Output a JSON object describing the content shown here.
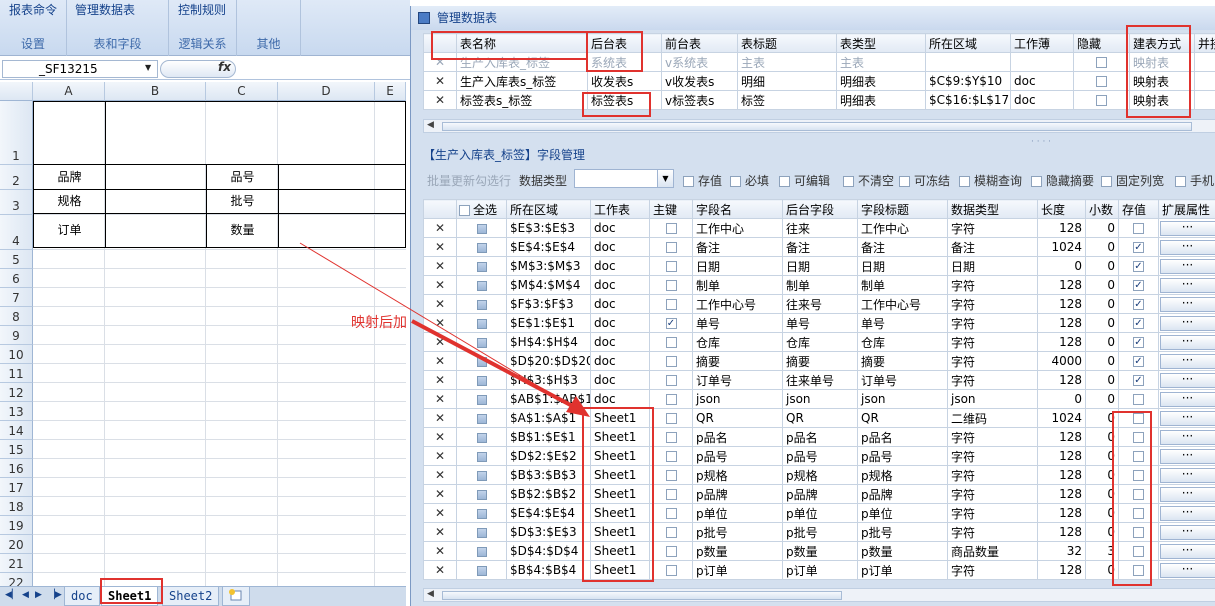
{
  "ribbon": {
    "groups": [
      {
        "button": "报表命令",
        "label": "设置"
      },
      {
        "button": "管理数据表",
        "label": "表和字段"
      },
      {
        "button": "控制规则",
        "label": "逻辑关系"
      },
      {
        "button": "",
        "label": "其他"
      }
    ]
  },
  "formula_bar": {
    "name_box": "_SF13215",
    "fx": "fx"
  },
  "sheet": {
    "columns": [
      "A",
      "B",
      "C",
      "D",
      "E"
    ],
    "rows": [
      "1",
      "2",
      "3",
      "4",
      "5",
      "6",
      "7",
      "8",
      "9",
      "10",
      "11",
      "12",
      "13",
      "14",
      "15",
      "16",
      "17",
      "18",
      "19",
      "20",
      "21",
      "22"
    ],
    "labels": {
      "brand": "品牌",
      "model": "品号",
      "spec": "规格",
      "batch": "批号",
      "order": "订单",
      "qty": "数量"
    },
    "tabs": [
      "doc",
      "Sheet1",
      "Sheet2"
    ],
    "active_tab": "Sheet1"
  },
  "annotation": "映射后加",
  "window": {
    "title": "管理数据表",
    "table_grid": {
      "headers": [
        "表名称",
        "后台表",
        "前台表",
        "表标题",
        "表类型",
        "所在区域",
        "工作薄",
        "隐藏",
        "建表方式",
        "并接"
      ],
      "rows": [
        {
          "name": "生产入库表_标签",
          "back": "系统表",
          "front": "v系统表",
          "title": "主表",
          "type": "主表",
          "range": "",
          "book": "",
          "hidden": false,
          "mode": "映射表",
          "gray": true
        },
        {
          "name": "生产入库表s_标签",
          "back": "收发表s",
          "front": "v收发表s",
          "title": "明细",
          "type": "明细表",
          "range": "$C$9:$Y$10",
          "book": "doc",
          "hidden": false,
          "mode": "映射表",
          "gray": false
        },
        {
          "name": "标签表s_标签",
          "back": "标签表s",
          "front": "v标签表s",
          "title": "标签",
          "type": "明细表",
          "range": "$C$16:$L$17",
          "book": "doc",
          "hidden": false,
          "mode": "映射表",
          "gray": false
        }
      ]
    },
    "field_section": {
      "title": "【生产入库表_标签】字段管理",
      "batch_update": "批量更新勾选行",
      "type_label": "数据类型",
      "filters": [
        "存值",
        "必填",
        "可编辑",
        "不清空",
        "可冻结",
        "模糊查询",
        "隐藏摘要",
        "固定列宽",
        "手机"
      ]
    },
    "field_grid": {
      "headers": [
        "全选",
        "所在区域",
        "工作表",
        "主键",
        "字段名",
        "后台字段",
        "字段标题",
        "数据类型",
        "长度",
        "小数",
        "存值",
        "扩展属性"
      ],
      "rows": [
        {
          "range": "$E$3:$E$3",
          "sheet": "doc",
          "pk": false,
          "field": "工作中心",
          "back": "往来",
          "title": "工作中心",
          "dtype": "字符",
          "len": "128",
          "dec": "0",
          "store": false
        },
        {
          "range": "$E$4:$E$4",
          "sheet": "doc",
          "pk": false,
          "field": "备注",
          "back": "备注",
          "title": "备注",
          "dtype": "备注",
          "len": "1024",
          "dec": "0",
          "store": true
        },
        {
          "range": "$M$3:$M$3",
          "sheet": "doc",
          "pk": false,
          "field": "日期",
          "back": "日期",
          "title": "日期",
          "dtype": "日期",
          "len": "0",
          "dec": "0",
          "store": true
        },
        {
          "range": "$M$4:$M$4",
          "sheet": "doc",
          "pk": false,
          "field": "制单",
          "back": "制单",
          "title": "制单",
          "dtype": "字符",
          "len": "128",
          "dec": "0",
          "store": true
        },
        {
          "range": "$F$3:$F$3",
          "sheet": "doc",
          "pk": false,
          "field": "工作中心号",
          "back": "往来号",
          "title": "工作中心号",
          "dtype": "字符",
          "len": "128",
          "dec": "0",
          "store": true
        },
        {
          "range": "$E$1:$E$1",
          "sheet": "doc",
          "pk": true,
          "field": "单号",
          "back": "单号",
          "title": "单号",
          "dtype": "字符",
          "len": "128",
          "dec": "0",
          "store": true
        },
        {
          "range": "$H$4:$H$4",
          "sheet": "doc",
          "pk": false,
          "field": "仓库",
          "back": "仓库",
          "title": "仓库",
          "dtype": "字符",
          "len": "128",
          "dec": "0",
          "store": true
        },
        {
          "range": "$D$20:$D$20",
          "sheet": "doc",
          "pk": false,
          "field": "摘要",
          "back": "摘要",
          "title": "摘要",
          "dtype": "字符",
          "len": "4000",
          "dec": "0",
          "store": true
        },
        {
          "range": "$H$3:$H$3",
          "sheet": "doc",
          "pk": false,
          "field": "订单号",
          "back": "往来单号",
          "title": "订单号",
          "dtype": "字符",
          "len": "128",
          "dec": "0",
          "store": true
        },
        {
          "range": "$AB$1:$AB$1",
          "sheet": "doc",
          "pk": false,
          "field": "json",
          "back": "json",
          "title": "json",
          "dtype": "json",
          "len": "0",
          "dec": "0",
          "store": false
        },
        {
          "range": "$A$1:$A$1",
          "sheet": "Sheet1",
          "pk": false,
          "field": "QR",
          "back": "QR",
          "title": "QR",
          "dtype": "二维码",
          "len": "1024",
          "dec": "0",
          "store": false
        },
        {
          "range": "$B$1:$E$1",
          "sheet": "Sheet1",
          "pk": false,
          "field": "p品名",
          "back": "p品名",
          "title": "p品名",
          "dtype": "字符",
          "len": "128",
          "dec": "0",
          "store": false
        },
        {
          "range": "$D$2:$E$2",
          "sheet": "Sheet1",
          "pk": false,
          "field": "p品号",
          "back": "p品号",
          "title": "p品号",
          "dtype": "字符",
          "len": "128",
          "dec": "0",
          "store": false
        },
        {
          "range": "$B$3:$B$3",
          "sheet": "Sheet1",
          "pk": false,
          "field": "p规格",
          "back": "p规格",
          "title": "p规格",
          "dtype": "字符",
          "len": "128",
          "dec": "0",
          "store": false
        },
        {
          "range": "$B$2:$B$2",
          "sheet": "Sheet1",
          "pk": false,
          "field": "p品牌",
          "back": "p品牌",
          "title": "p品牌",
          "dtype": "字符",
          "len": "128",
          "dec": "0",
          "store": false
        },
        {
          "range": "$E$4:$E$4",
          "sheet": "Sheet1",
          "pk": false,
          "field": "p单位",
          "back": "p单位",
          "title": "p单位",
          "dtype": "字符",
          "len": "128",
          "dec": "0",
          "store": false
        },
        {
          "range": "$D$3:$E$3",
          "sheet": "Sheet1",
          "pk": false,
          "field": "p批号",
          "back": "p批号",
          "title": "p批号",
          "dtype": "字符",
          "len": "128",
          "dec": "0",
          "store": false
        },
        {
          "range": "$D$4:$D$4",
          "sheet": "Sheet1",
          "pk": false,
          "field": "p数量",
          "back": "p数量",
          "title": "p数量",
          "dtype": "商品数量",
          "len": "32",
          "dec": "3",
          "store": false
        },
        {
          "range": "$B$4:$B$4",
          "sheet": "Sheet1",
          "pk": false,
          "field": "p订单",
          "back": "p订单",
          "title": "p订单",
          "dtype": "字符",
          "len": "128",
          "dec": "0",
          "store": false
        }
      ]
    },
    "ellipsis": "···"
  },
  "colors": {
    "highlight": "#e0322e",
    "title_blue": "#15428b",
    "window_bg": "#d4e0ef"
  }
}
